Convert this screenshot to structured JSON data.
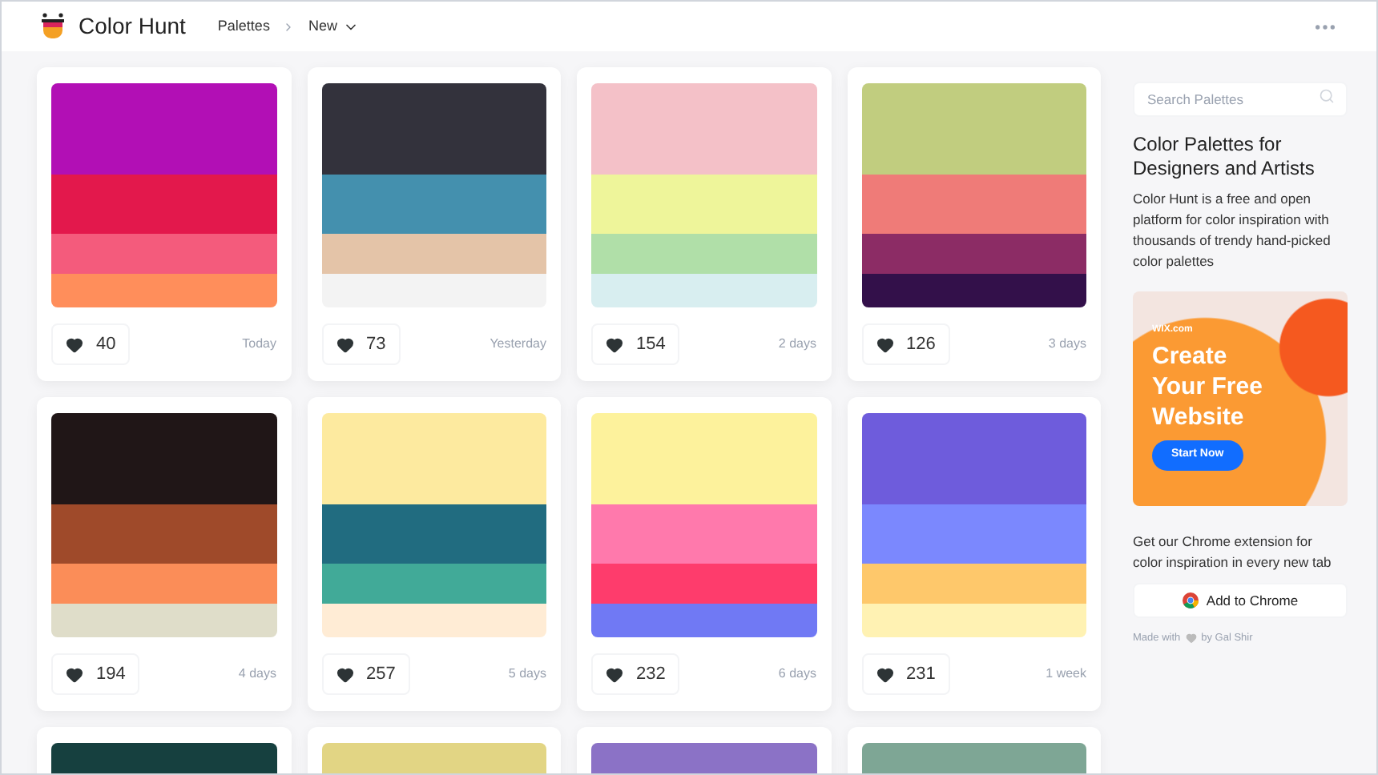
{
  "header": {
    "brand": "Color Hunt",
    "breadcrumb": [
      "Palettes",
      "New"
    ]
  },
  "palettes": [
    {
      "likes": "40",
      "age": "Today",
      "swatches": [
        {
          "color": "#b20fb5"
        },
        {
          "color": "#e3184c"
        },
        {
          "color": "#f45b7c"
        },
        {
          "color": "#ff8e5b"
        }
      ]
    },
    {
      "likes": "73",
      "age": "Yesterday",
      "swatches": [
        {
          "color": "#33323c"
        },
        {
          "color": "#4490ae"
        },
        {
          "color": "#e4c4a8"
        },
        {
          "color": "#f3f3f3"
        }
      ]
    },
    {
      "likes": "154",
      "age": "2 days",
      "swatches": [
        {
          "color": "#f4c1c8"
        },
        {
          "color": "#eef59a"
        },
        {
          "color": "#b0dfa8"
        },
        {
          "color": "#d8eef0"
        }
      ]
    },
    {
      "likes": "126",
      "age": "3 days",
      "swatches": [
        {
          "color": "#c1cd7f"
        },
        {
          "color": "#ef7b78"
        },
        {
          "color": "#8c2c65"
        },
        {
          "color": "#33104a"
        }
      ]
    },
    {
      "likes": "194",
      "age": "4 days",
      "swatches": [
        {
          "color": "#201617"
        },
        {
          "color": "#9f4a2a"
        },
        {
          "color": "#fb8d58"
        },
        {
          "color": "#dfddc9"
        }
      ]
    },
    {
      "likes": "257",
      "age": "5 days",
      "swatches": [
        {
          "color": "#fdea9f"
        },
        {
          "color": "#216c80"
        },
        {
          "color": "#41aa98"
        },
        {
          "color": "#ffecd5"
        }
      ]
    },
    {
      "likes": "232",
      "age": "6 days",
      "swatches": [
        {
          "color": "#fdf29c"
        },
        {
          "color": "#ff79ac"
        },
        {
          "color": "#fe3c6c"
        },
        {
          "color": "#7079f4"
        }
      ]
    },
    {
      "likes": "231",
      "age": "1 week",
      "swatches": [
        {
          "color": "#6e5cdc"
        },
        {
          "color": "#7b88fe"
        },
        {
          "color": "#fec86b"
        },
        {
          "color": "#fff2b3"
        }
      ]
    },
    {
      "swatches": [
        {
          "color": "#16403f"
        }
      ]
    },
    {
      "swatches": [
        {
          "color": "#e2d584"
        }
      ]
    },
    {
      "swatches": [
        {
          "color": "#8b72c6"
        }
      ]
    },
    {
      "swatches": [
        {
          "color": "#7ea695"
        }
      ]
    }
  ],
  "sidebar": {
    "search": {
      "placeholder": "Search Palettes"
    },
    "heading": "Color Palettes for Designers and Artists",
    "description": "Color Hunt is a free and open platform for color inspiration with thousands of trendy hand-picked color palettes",
    "ad": {
      "logo": "WIX.com",
      "headline": "Create Your Free Website",
      "button": "Start Now"
    },
    "extension_text": "Get our Chrome extension for color inspiration in every new tab",
    "extension_button": "Add to Chrome",
    "credit_before": "Made with",
    "credit_after": "by Gal Shir"
  }
}
